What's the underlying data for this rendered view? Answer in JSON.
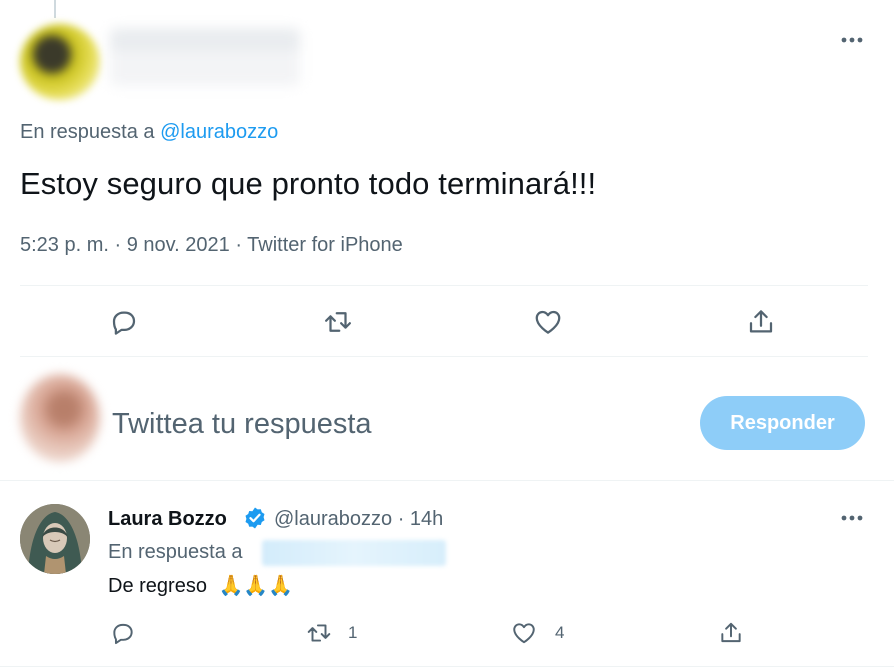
{
  "main_tweet": {
    "reply_to_prefix": "En respuesta a",
    "reply_to_handle": "@laurabozzo",
    "text": "Estoy seguro que pronto todo terminará!!!",
    "meta": "5:23 p. m. · 9 nov. 2021 · Twitter for iPhone",
    "actions": [
      "reply-icon",
      "retweet-icon",
      "like-icon",
      "share-icon"
    ]
  },
  "composer": {
    "placeholder": "Twittea tu respuesta",
    "button_label": "Responder"
  },
  "reply_tweet": {
    "name": "Laura Bozzo",
    "handle_time": "@laurabozzo · 14h",
    "reply_to_prefix": "En respuesta a",
    "text": "De regreso",
    "emoji": "🙏🙏🙏",
    "retweet_count": "1",
    "like_count": "4"
  },
  "colors": {
    "accent": "#1d9bf0",
    "secondary_text": "#536471",
    "button_disabled": "#8ecdf8"
  }
}
